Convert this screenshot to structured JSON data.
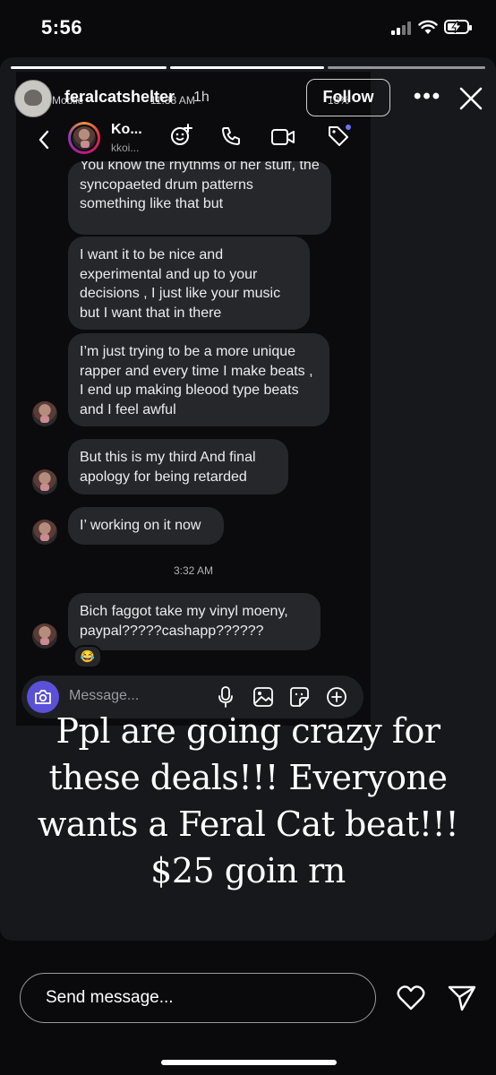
{
  "status_bar": {
    "time": "5:56",
    "battery_percent": 40
  },
  "story": {
    "username": "feralcatshelter",
    "age": "1h",
    "follow_label": "Follow",
    "progress_segments": [
      1,
      1,
      0
    ],
    "overlay_status_left": "Mobile",
    "overlay_status_time": "11:38 AM",
    "overlay_status_right": "13%"
  },
  "dm": {
    "contact_name": "Ko...",
    "contact_handle": "kkoi...",
    "messages": [
      "You know the rhythms of her stuff, the syncopaeted drum patterns something like that but",
      "I want it to be nice and experimental and up to your decisions , I just like your music but I want that in there",
      "I’m just trying to be a more unique rapper and every time I make beats , I end up making bleood type beats and I feel awful",
      "But this is my third And final apology for being retarded",
      "I’ working on it now",
      "Bich faggot take my vinyl moeny, paypal?????cashapp??????"
    ],
    "timestamp": "3:32 AM",
    "reaction": "😂",
    "composer_placeholder": "Message..."
  },
  "caption": {
    "lines": [
      "Ppl are going crazy for",
      "these deals!!! Everyone",
      "wants a Feral Cat beat!!!",
      "$25 goin rn"
    ]
  },
  "reply": {
    "placeholder": "Send message..."
  }
}
